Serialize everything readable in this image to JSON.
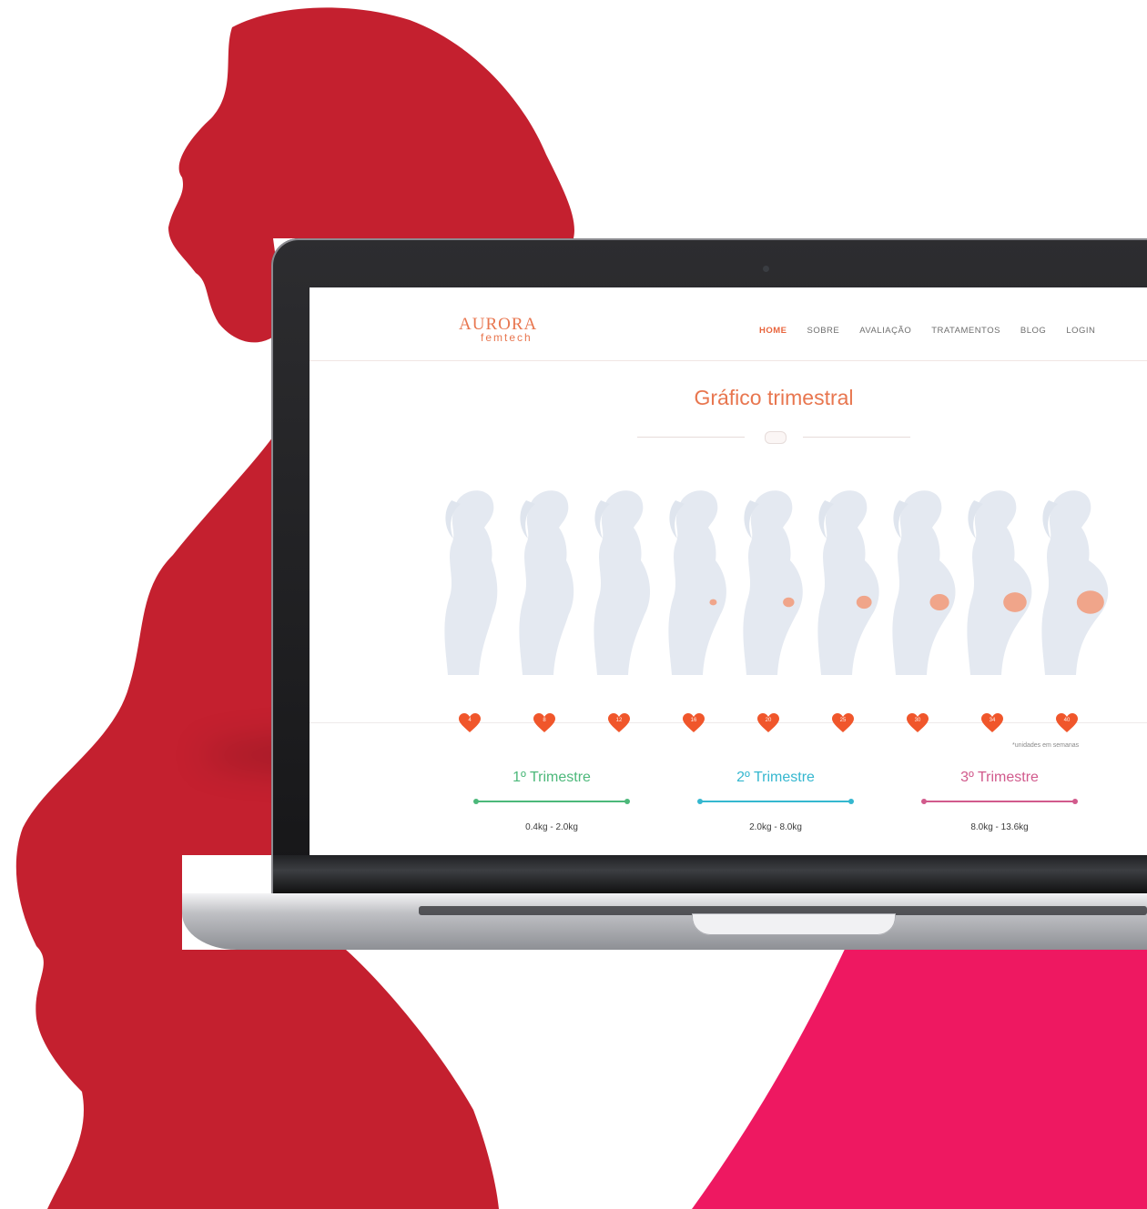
{
  "colors": {
    "red_silhouette": "#c4202f",
    "magenta_shape": "#ee1861",
    "brand_orange": "#e8764f",
    "heart_orange": "#f0562b",
    "trimester1": "#4cb87a",
    "trimester2": "#35b7cf",
    "trimester3": "#d15a8c"
  },
  "brand": {
    "name": "AURORA",
    "tagline": "femtech"
  },
  "nav": {
    "items": [
      {
        "label": "HOME",
        "active": true
      },
      {
        "label": "SOBRE"
      },
      {
        "label": "AVALIAÇÃO"
      },
      {
        "label": "TRATAMENTOS"
      },
      {
        "label": "BLOG"
      },
      {
        "label": "LOGIN"
      }
    ]
  },
  "page": {
    "title": "Gráfico trimestral",
    "units_note": "*unidades em semanas"
  },
  "weeks": [
    "4",
    "8",
    "12",
    "16",
    "20",
    "25",
    "30",
    "34",
    "40"
  ],
  "trimesters": [
    {
      "label": "1º Trimestre",
      "range": "0.4kg - 2.0kg",
      "color_key": "trimester1"
    },
    {
      "label": "2º Trimestre",
      "range": "2.0kg - 8.0kg",
      "color_key": "trimester2"
    },
    {
      "label": "3º Trimestre",
      "range": "8.0kg - 13.6kg",
      "color_key": "trimester3"
    }
  ]
}
